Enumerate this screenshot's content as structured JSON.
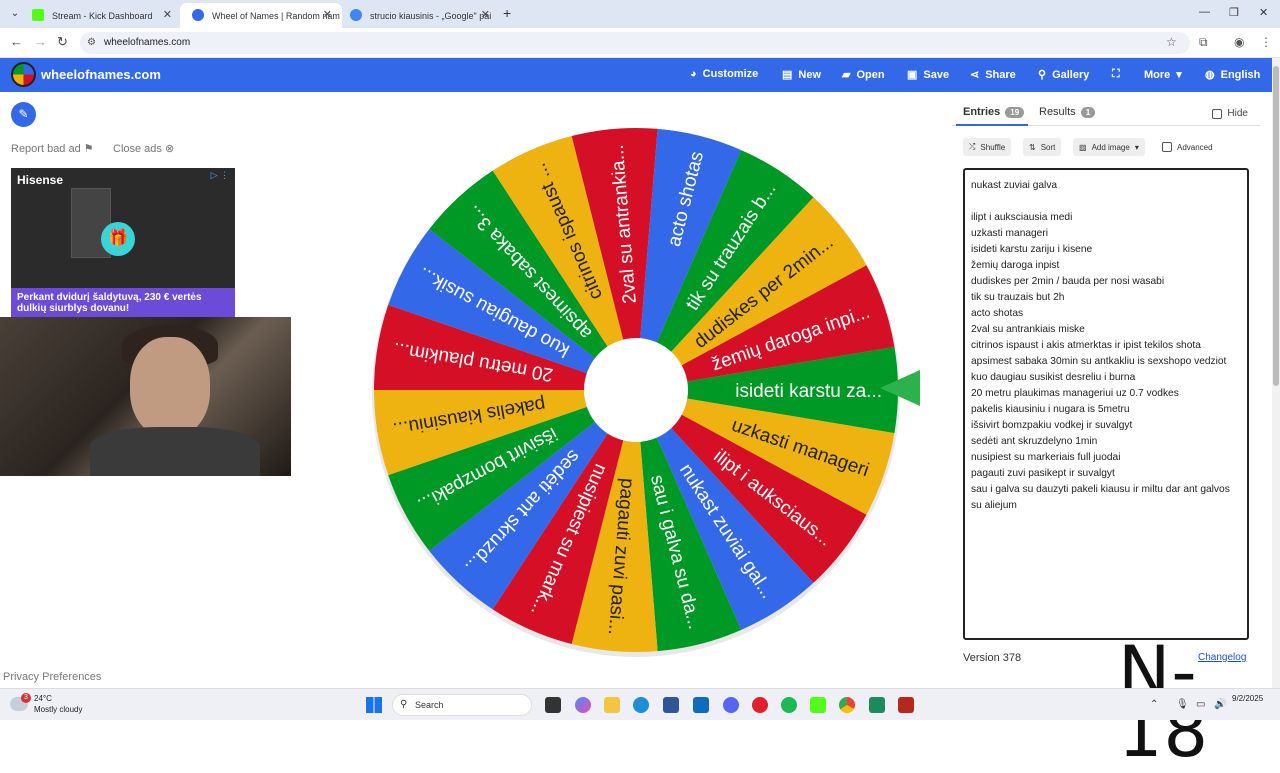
{
  "browser": {
    "tabs": [
      {
        "title": "Stream - Kick Dashboard",
        "favicon_color": "#53fc18"
      },
      {
        "title": "Wheel of Names | Random nam",
        "favicon_color": "#3369e8"
      },
      {
        "title": "strucio kiausinis - „Google\" pai",
        "favicon_color": "#4285f4"
      }
    ],
    "url": "wheelofnames.com"
  },
  "header": {
    "brand": "wheelofnames.com",
    "menu": [
      "Customize",
      "New",
      "Open",
      "Save",
      "Share",
      "Gallery",
      "",
      "More",
      "English"
    ]
  },
  "left": {
    "report_ad": "Report bad ad",
    "close_ads": "Close ads",
    "ad_brand": "Hisense",
    "ad_promo": "Perkant dvidurį šaldytuvą, 230 € vertės dulkių siurblys dovanu!",
    "privacy": "Privacy Preferences"
  },
  "wheel": {
    "colors": [
      "#009925",
      "#eeb211",
      "#d50f25",
      "#3369e8"
    ],
    "segments": [
      "isideti karstu za...",
      "uzkasti manageri",
      "ilipt i auksciaus...",
      "nukast zuviai gal...",
      "sau i galva su da...",
      "pagauti zuvi pasi...",
      "nusipiest su mark...",
      "sedėti ant skruzd...",
      "išsivirt bomzpaki...",
      "pakelis kiausiniu...",
      "20 metru plaukim...",
      "kuo daugiau susik...",
      "apsimest sabaka 3...",
      "citrinos ispaust ...",
      "2val su antrankia...",
      "acto shotas",
      "tik su trauzais b...",
      "dudiskes per 2min...",
      "žemių daroga inpi..."
    ]
  },
  "sidebar": {
    "entries_tab": "Entries",
    "entries_count": "19",
    "results_tab": "Results",
    "results_count": "1",
    "hide": "Hide",
    "tools": [
      "Shuffle",
      "Sort",
      "Add image"
    ],
    "advanced": "Advanced",
    "entries": [
      "nukast zuviai galva",
      "",
      "ilipt i auksciausia medi",
      "uzkasti manageri",
      "isideti karstu zariju i kisene",
      "žemių daroga inpist",
      "dudiskes per 2min  / bauda per nosi wasabi",
      "tik su trauzais but 2h",
      "acto shotas",
      "2val su antrankiais miske",
      "citrinos ispaust i akis atmerktas ir ipist tekilos shota",
      "apsimest sabaka 30min su antkakliu is sexshopo vedziot",
      "kuo daugiau susikist desreliu i burna",
      " 20 metru plaukimas manageriui uz 0.7 vodkes",
      "pakelis kiausiniu i nugara is 5metru",
      "išsivirt bomzpakiu vodkej ir suvalgyt",
      "sedėti ant skruzdelyno 1min",
      "nusipiest su markeriais full juodai",
      "pagauti zuvi pasikept ir suvalgyt",
      "sau i galva su dauzyti pakeli kiausu ir miltu dar ant galvos",
      "su aliejum"
    ],
    "version": "Version 378",
    "changelog": "Changelog"
  },
  "watermark": "N-18",
  "taskbar": {
    "temp": "24°C",
    "condition": "Mostly cloudy",
    "weather_badge": "3",
    "search": "Search",
    "date": "9/2/2025",
    "time": ""
  }
}
